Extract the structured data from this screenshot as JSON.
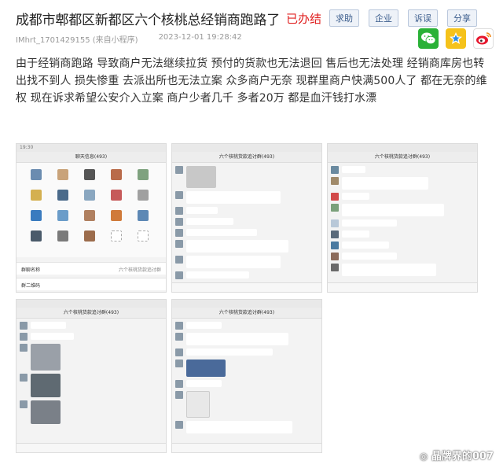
{
  "header": {
    "title": "成都市郫都区新都区六个核桃总经销商跑路了",
    "status": "已办结",
    "tags": [
      "求助",
      "企业",
      "诉误",
      "分享"
    ]
  },
  "meta": {
    "author": "IMhrt_1701429155 (来自小程序)",
    "datetime": "2023-12-01 19:28:42"
  },
  "share": {
    "icons": [
      "wechat-icon",
      "qzone-icon",
      "weibo-icon"
    ],
    "colors": {
      "wechat": "#2ab137",
      "qzone": "#f5c21a",
      "weibo": "#e6162d"
    }
  },
  "post": {
    "text": "由于经销商跑路 导致商户无法继续拉货 预付的货款也无法退回 售后也无法处理 经销商库房也转出找不到人 损失惨重 去派出所也无法立案 众多商户无奈 现群里商户快满500人了 都在无奈的维权 现在诉求希望公安介入立案 商户少者几千 多者20万 都是血汗钱打水漂"
  },
  "screenshots": [
    {
      "header": "聊天信息(493)",
      "status_time": "19:30",
      "footer_rows": [
        "群聊名称",
        "群二维码"
      ],
      "footer_values": [
        "六个核桃货款追讨群"
      ]
    },
    {
      "header": "六个核桃货款追讨群(493)",
      "status_time": "",
      "footer_rows": [],
      "footer_values": []
    },
    {
      "header": "六个核桃货款追讨群(493)",
      "status_time": "",
      "footer_rows": [],
      "footer_values": []
    },
    {
      "header": "六个核桃货款追讨群(493)",
      "status_time": "",
      "footer_rows": [],
      "footer_values": []
    },
    {
      "header": "六个核桃货款追讨群(493)",
      "status_time": "",
      "footer_rows": [],
      "footer_values": []
    }
  ],
  "watermark": "晶牌界的007"
}
